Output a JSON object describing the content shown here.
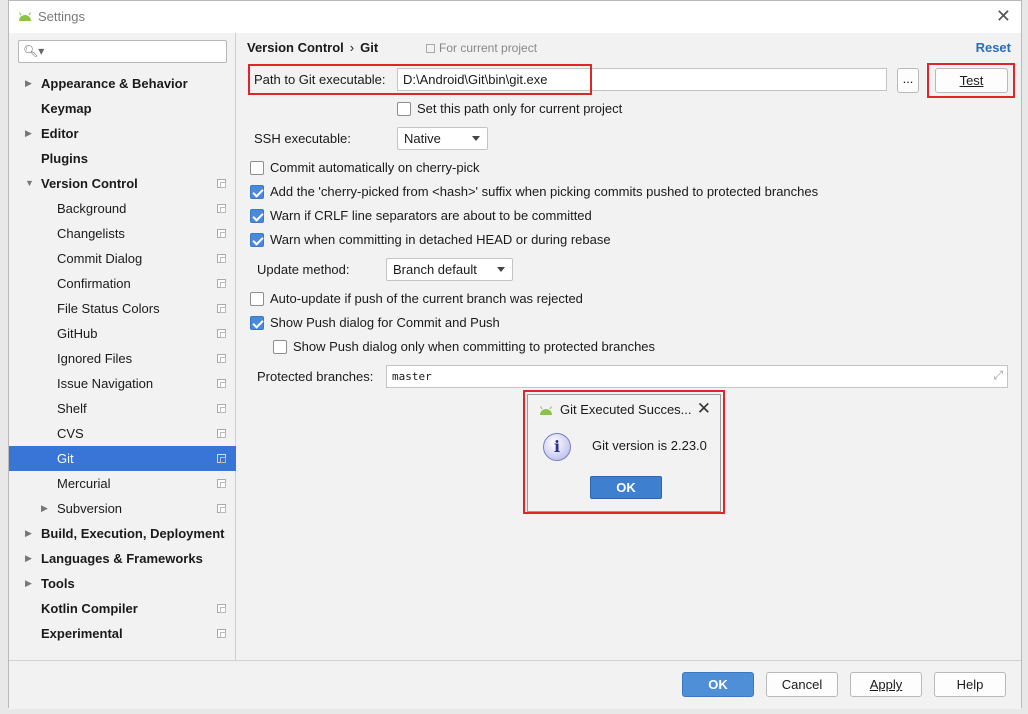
{
  "window": {
    "title": "Settings"
  },
  "search": {
    "placeholder": ""
  },
  "sidebar": {
    "items": [
      {
        "label": "Appearance & Behavior",
        "bold": true,
        "arrow": "▶",
        "indent": 0,
        "copy": false
      },
      {
        "label": "Keymap",
        "bold": true,
        "arrow": "",
        "indent": 0,
        "copy": false
      },
      {
        "label": "Editor",
        "bold": true,
        "arrow": "▶",
        "indent": 0,
        "copy": false
      },
      {
        "label": "Plugins",
        "bold": true,
        "arrow": "",
        "indent": 0,
        "copy": false
      },
      {
        "label": "Version Control",
        "bold": true,
        "arrow": "▼",
        "indent": 0,
        "copy": true
      },
      {
        "label": "Background",
        "bold": false,
        "arrow": "",
        "indent": 1,
        "copy": true
      },
      {
        "label": "Changelists",
        "bold": false,
        "arrow": "",
        "indent": 1,
        "copy": true
      },
      {
        "label": "Commit Dialog",
        "bold": false,
        "arrow": "",
        "indent": 1,
        "copy": true
      },
      {
        "label": "Confirmation",
        "bold": false,
        "arrow": "",
        "indent": 1,
        "copy": true
      },
      {
        "label": "File Status Colors",
        "bold": false,
        "arrow": "",
        "indent": 1,
        "copy": true
      },
      {
        "label": "GitHub",
        "bold": false,
        "arrow": "",
        "indent": 1,
        "copy": true
      },
      {
        "label": "Ignored Files",
        "bold": false,
        "arrow": "",
        "indent": 1,
        "copy": true
      },
      {
        "label": "Issue Navigation",
        "bold": false,
        "arrow": "",
        "indent": 1,
        "copy": true
      },
      {
        "label": "Shelf",
        "bold": false,
        "arrow": "",
        "indent": 1,
        "copy": true
      },
      {
        "label": "CVS",
        "bold": false,
        "arrow": "",
        "indent": 1,
        "copy": true
      },
      {
        "label": "Git",
        "bold": false,
        "arrow": "",
        "indent": 1,
        "copy": true,
        "selected": true
      },
      {
        "label": "Mercurial",
        "bold": false,
        "arrow": "",
        "indent": 1,
        "copy": true
      },
      {
        "label": "Subversion",
        "bold": false,
        "arrow": "▶",
        "indent": 1,
        "copy": true
      },
      {
        "label": "Build, Execution, Deployment",
        "bold": true,
        "arrow": "▶",
        "indent": 0,
        "copy": false
      },
      {
        "label": "Languages & Frameworks",
        "bold": true,
        "arrow": "▶",
        "indent": 0,
        "copy": false
      },
      {
        "label": "Tools",
        "bold": true,
        "arrow": "▶",
        "indent": 0,
        "copy": false
      },
      {
        "label": "Kotlin Compiler",
        "bold": true,
        "arrow": "",
        "indent": 0,
        "copy": true
      },
      {
        "label": "Experimental",
        "bold": true,
        "arrow": "",
        "indent": 0,
        "copy": true
      }
    ]
  },
  "header": {
    "crumb_parent": "Version Control",
    "crumb_sep": "›",
    "crumb_current": "Git",
    "scope": "For current project",
    "reset": "Reset"
  },
  "git": {
    "path_label": "Path to Git executable:",
    "path_value": "D:\\Android\\Git\\bin\\git.exe",
    "browse_label": "...",
    "test_label": "Test",
    "set_path_label": "Set this path only for current project",
    "ssh_label": "SSH executable:",
    "ssh_value": "Native",
    "cb_cherry_pick": "Commit automatically on cherry-pick",
    "cb_add_suffix": "Add the 'cherry-picked from <hash>' suffix when picking commits pushed to protected branches",
    "cb_warn_crlf": "Warn if CRLF line separators are about to be committed",
    "cb_warn_detached": "Warn when committing in detached HEAD or during rebase",
    "update_label": "Update method:",
    "update_value": "Branch default",
    "cb_auto_update": "Auto-update if push of the current branch was rejected",
    "cb_show_push": "Show Push dialog for Commit and Push",
    "cb_show_push_protected": "Show Push dialog only when committing to protected branches",
    "protected_label": "Protected branches:",
    "protected_value": "master"
  },
  "dialog": {
    "title": "Git Executed Succes...",
    "message": "Git version is 2.23.0",
    "ok": "OK"
  },
  "footer": {
    "ok": "OK",
    "cancel": "Cancel",
    "apply": "Apply",
    "help": "Help"
  },
  "colors": {
    "accent": "#3875d7",
    "highlight": "#e0242b",
    "link": "#2a6ebb"
  }
}
